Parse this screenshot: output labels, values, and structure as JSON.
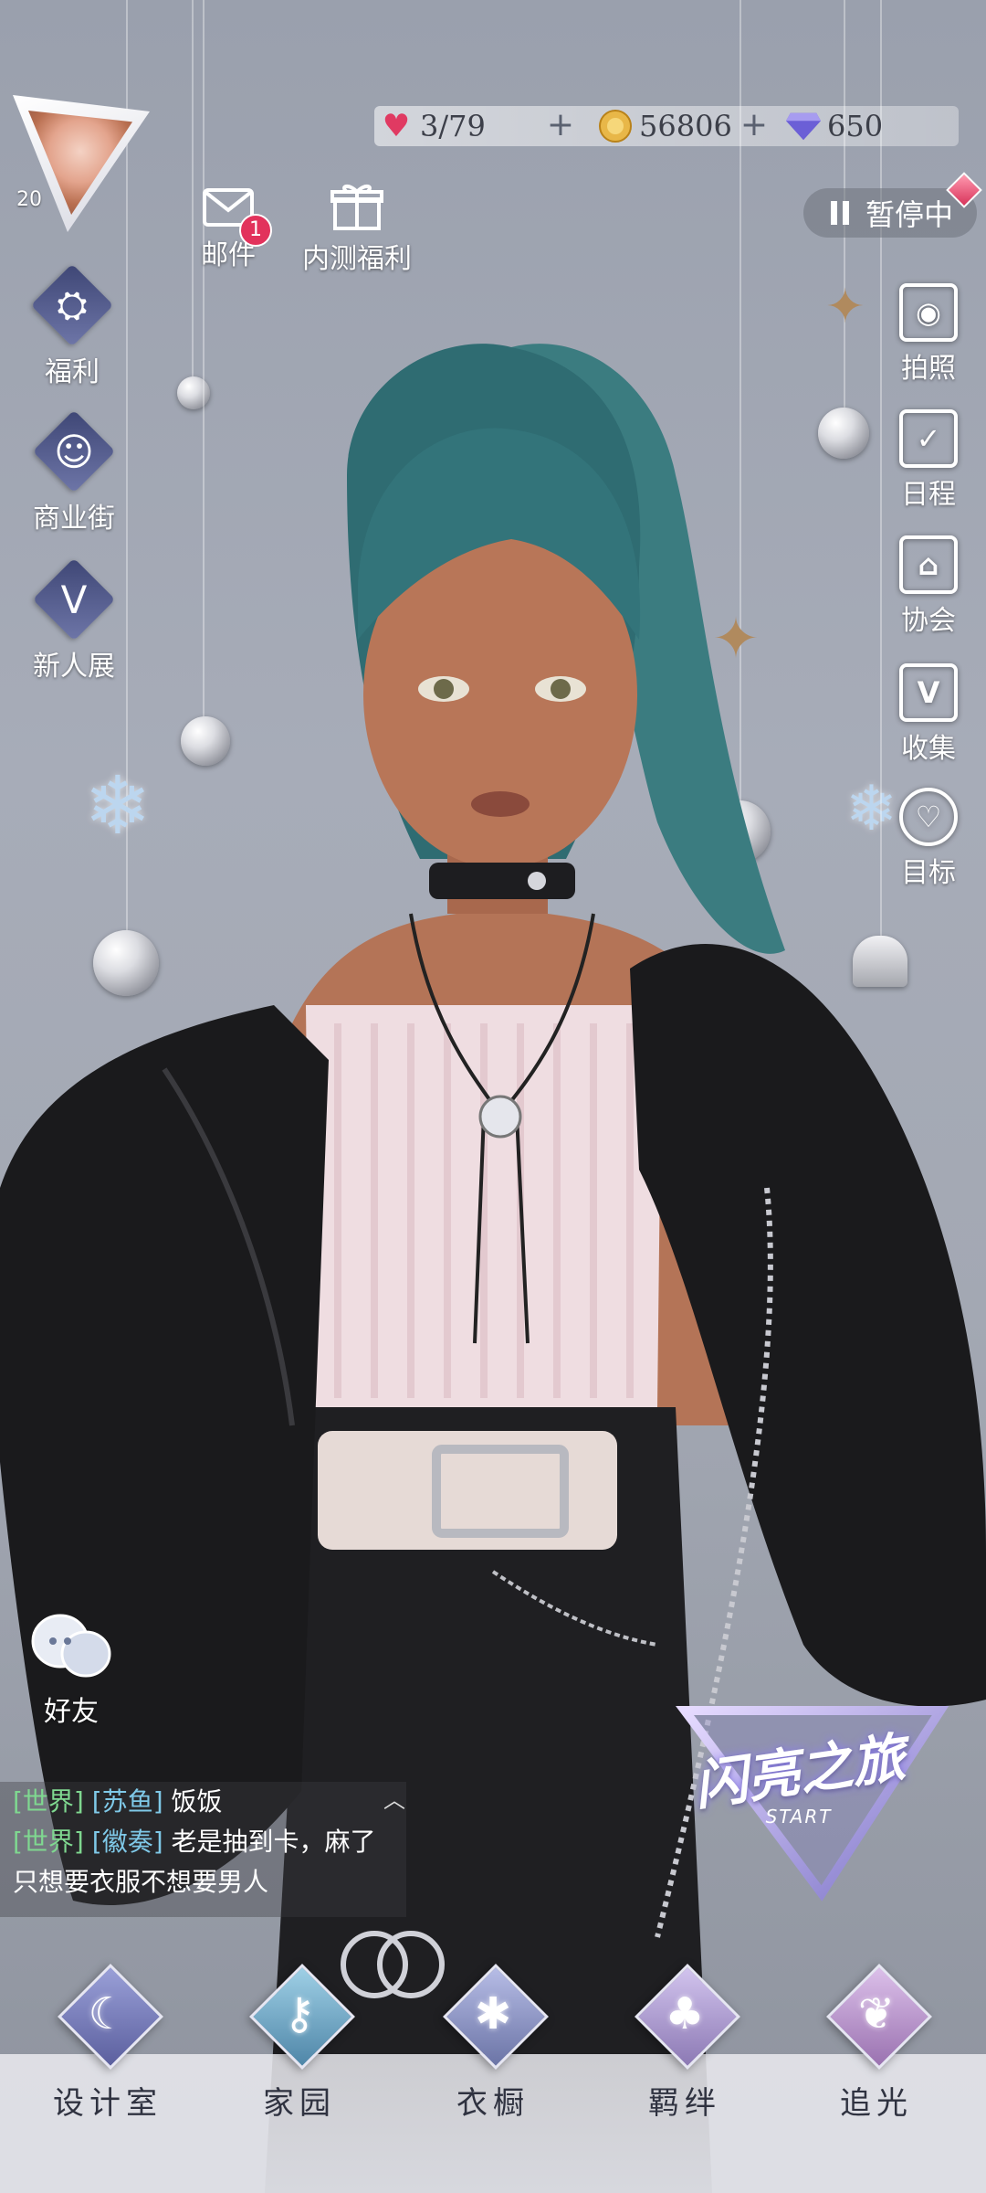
{
  "player": {
    "level": "20"
  },
  "resources": {
    "stamina": "3/79",
    "coins": "56806",
    "diamonds": "650"
  },
  "top_left_buttons": {
    "mail_label": "邮件",
    "mail_badge": "1",
    "beta_welfare_label": "内测福利"
  },
  "left_menu": [
    {
      "label": "福利",
      "icon": "balloon-icon"
    },
    {
      "label": "商业街",
      "icon": "shopping-bag-icon"
    },
    {
      "label": "新人展",
      "icon": "crown-v-icon"
    }
  ],
  "pause": {
    "label": "暂停中"
  },
  "right_menu": [
    {
      "label": "拍照",
      "icon": "camera-icon"
    },
    {
      "label": "日程",
      "icon": "calendar-check-icon"
    },
    {
      "label": "协会",
      "icon": "building-icon"
    },
    {
      "label": "收集",
      "icon": "collection-v-icon"
    },
    {
      "label": "目标",
      "icon": "target-badge-icon"
    }
  ],
  "friends": {
    "label": "好友"
  },
  "chat": {
    "lines": [
      {
        "channel": "[世界]",
        "user": "[苏鱼]",
        "message": "饭饭"
      },
      {
        "channel": "[世界]",
        "user": "[徽奏]",
        "message": "老是抽到卡，麻了"
      },
      {
        "channel": "",
        "user": "",
        "message": "只想要衣服不想要男人"
      }
    ]
  },
  "event_logo": {
    "main": "闪亮之旅",
    "sub": "START"
  },
  "bottom_nav": [
    {
      "label": "设计室",
      "icon": "moon-icon",
      "color": "#5b5f9e"
    },
    {
      "label": "家园",
      "icon": "key-icon",
      "color": "#4f86a8"
    },
    {
      "label": "衣橱",
      "icon": "snowflake-gem-icon",
      "color": "#6b74a6"
    },
    {
      "label": "羁绊",
      "icon": "clover-icon",
      "color": "#8c79b4"
    },
    {
      "label": "追光",
      "icon": "butterfly-icon",
      "color": "#9a72b0"
    }
  ]
}
